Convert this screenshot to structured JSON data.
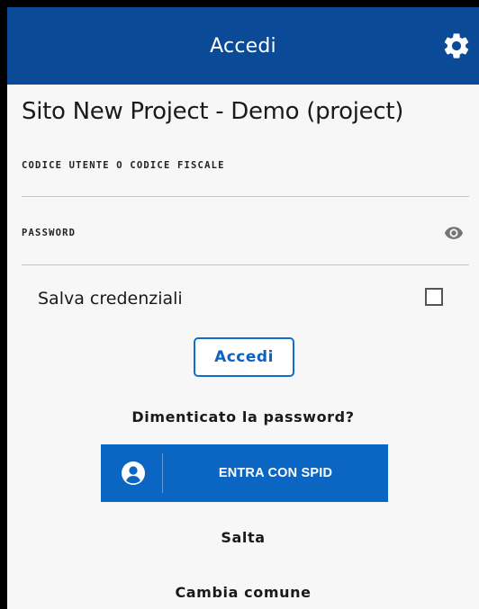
{
  "header": {
    "title": "Accedi",
    "settings_icon": "gear-icon"
  },
  "site": {
    "title": "Sito New Project - Demo (project)"
  },
  "form": {
    "user_label": "CODICE UTENTE O CODICE FISCALE",
    "user_value": "",
    "password_label": "PASSWORD",
    "password_value": "",
    "password_toggle_icon": "eye-icon",
    "save_label": "Salva credenziali",
    "save_checked": false
  },
  "actions": {
    "login_label": "Accedi",
    "forgot_label": "Dimenticato la password?",
    "spid_label": "ENTRA CON SPID",
    "spid_icon": "user-icon",
    "skip_label": "Salta",
    "change_label": "Cambia comune"
  },
  "colors": {
    "app_bar": "#0b4a96",
    "primary": "#0a66c2",
    "background": "#f7f7f7"
  }
}
